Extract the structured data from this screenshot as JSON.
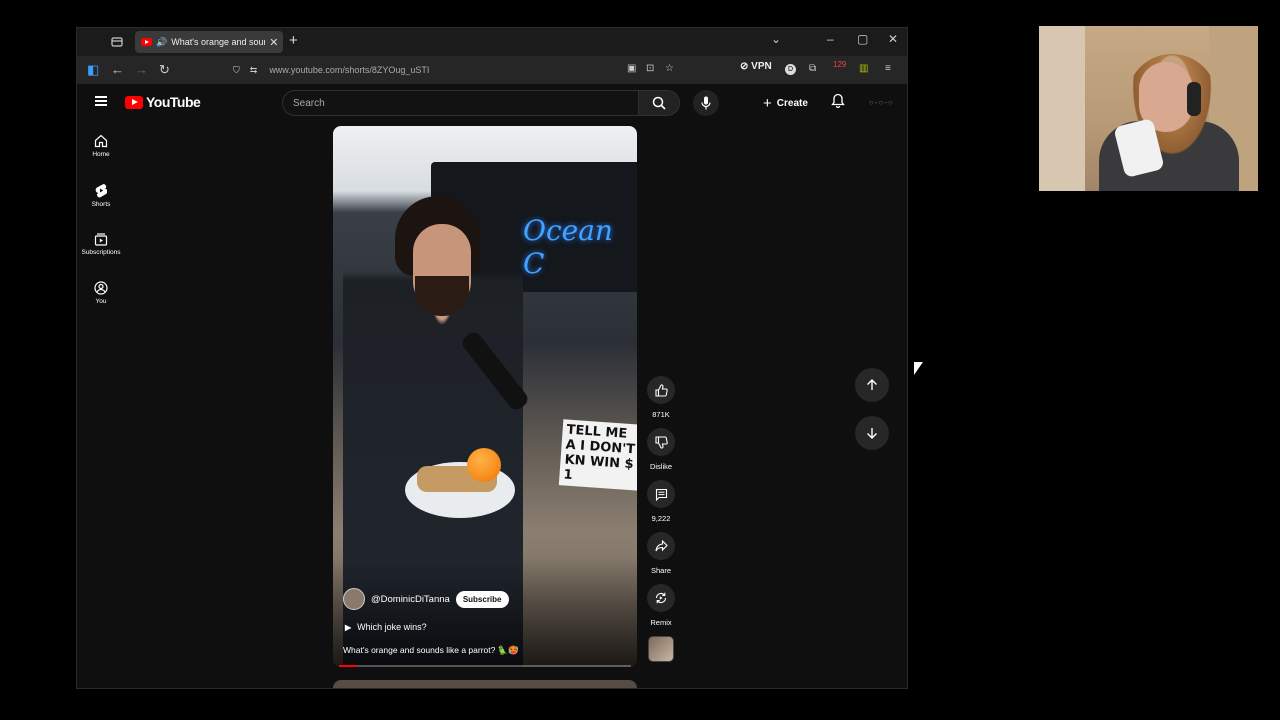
{
  "browser": {
    "tab_title": "What's orange and sounds",
    "new_tab": "+",
    "close_tab": "✕",
    "url": "www.youtube.com/shorts/8ZYOug_uSTI",
    "vpn_label": "VPN",
    "ext_badge": "129",
    "window_controls": {
      "minimize": "–",
      "maximize": "▢",
      "close": "✕"
    }
  },
  "youtube": {
    "logo_text": "YouTube",
    "search_placeholder": "Search",
    "create_label": "Create",
    "sidebar": [
      {
        "label": "Home",
        "icon": "home-icon"
      },
      {
        "label": "Shorts",
        "icon": "shorts-icon"
      },
      {
        "label": "Subscriptions",
        "icon": "subscriptions-icon"
      },
      {
        "label": "You",
        "icon": "you-icon"
      }
    ],
    "short": {
      "sign_text": "Ocean C",
      "held_sign": "TELL ME A I DON'T KN WIN $ 1",
      "channel": "@DominicDiTanna",
      "subscribe_label": "Subscribe",
      "playlist": "Which joke wins?",
      "caption": "What's orange and sounds like a parrot? 🦜🥵",
      "progress": 0.06
    },
    "actions": {
      "like_count": "871K",
      "dislike_label": "Dislike",
      "comment_count": "9,222",
      "share_label": "Share",
      "remix_label": "Remix"
    }
  }
}
